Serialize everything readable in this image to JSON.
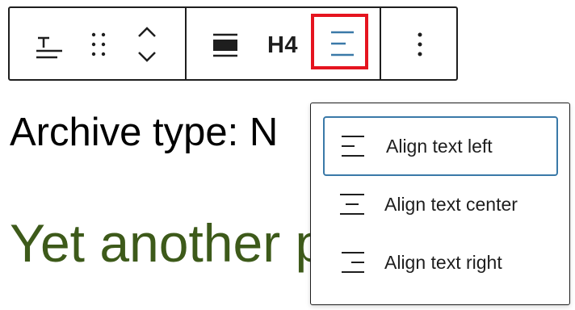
{
  "toolbar": {
    "buttons": [
      {
        "name": "transform-to-icon"
      },
      {
        "name": "drag-handle-icon"
      },
      {
        "name": "move-up-down-icon"
      },
      {
        "name": "align-full-width-icon"
      },
      {
        "name": "heading-level",
        "label": "H4"
      },
      {
        "name": "align-text-left-icon",
        "active": true
      },
      {
        "name": "more-options-icon"
      }
    ],
    "heading_level_label": "H4",
    "active_color": "#3a79a8",
    "highlight_color": "#e5141f"
  },
  "content": {
    "archive_heading": "Archive type: N",
    "another_heading": "Yet another p",
    "another_heading_color": "#3d5a1a"
  },
  "alignment_menu": {
    "items": [
      {
        "label": "Align text left",
        "icon": "align-left-icon",
        "selected": true
      },
      {
        "label": "Align text center",
        "icon": "align-center-icon",
        "selected": false
      },
      {
        "label": "Align text right",
        "icon": "align-right-icon",
        "selected": false
      }
    ]
  }
}
